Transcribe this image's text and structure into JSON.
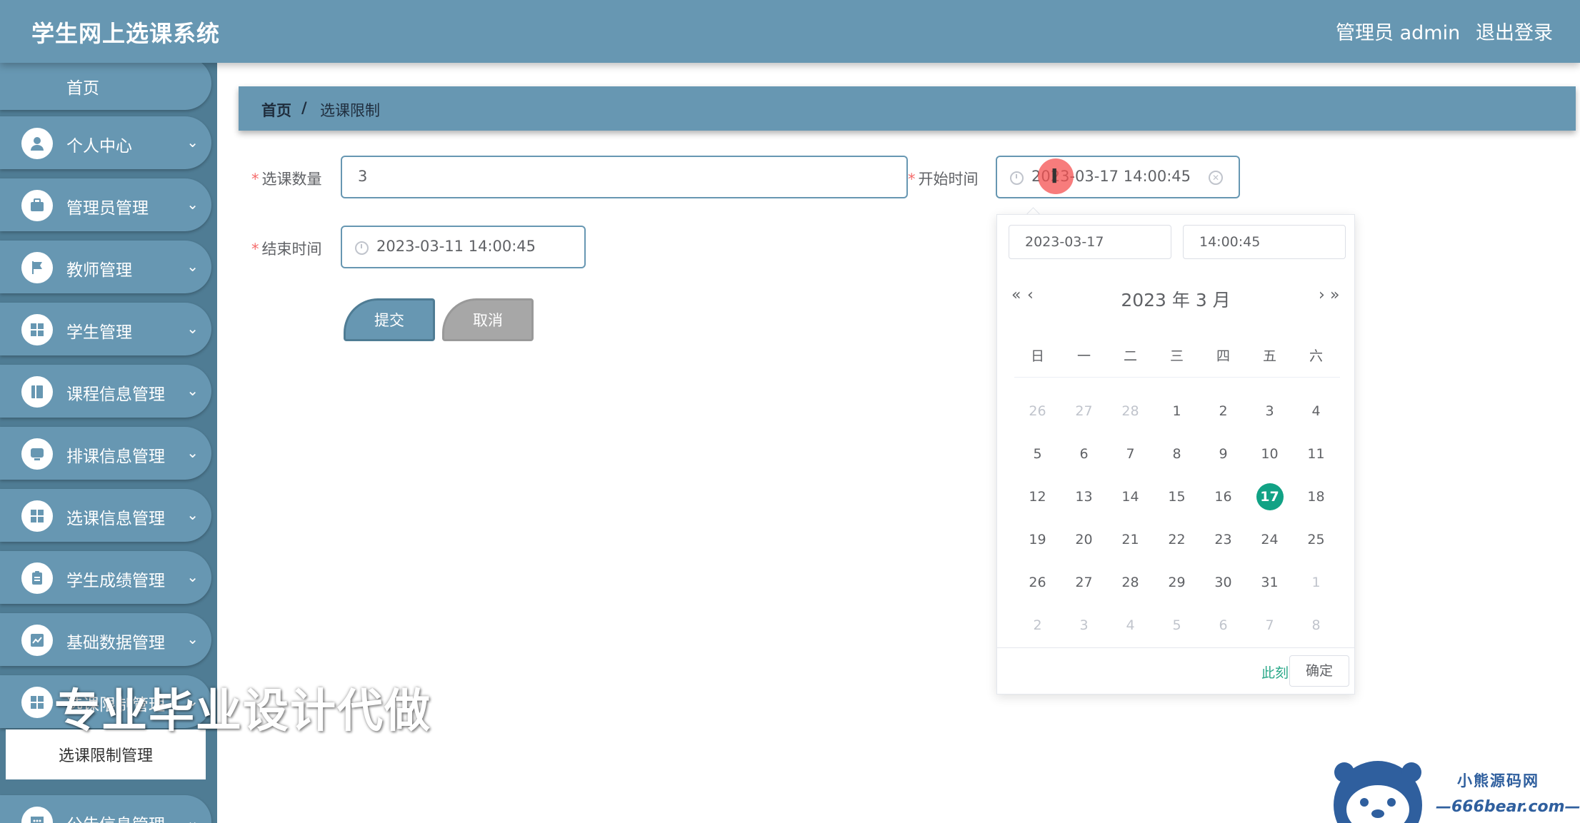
{
  "header": {
    "title": "学生网上选课系统",
    "user": "管理员 admin",
    "logout": "退出登录"
  },
  "sidebar": {
    "home": "首页",
    "items": [
      {
        "label": "个人中心",
        "icon": "user-icon"
      },
      {
        "label": "管理员管理",
        "icon": "briefcase-icon"
      },
      {
        "label": "教师管理",
        "icon": "flag-icon"
      },
      {
        "label": "学生管理",
        "icon": "grid-icon"
      },
      {
        "label": "课程信息管理",
        "icon": "book-icon"
      },
      {
        "label": "排课信息管理",
        "icon": "monitor-icon"
      },
      {
        "label": "选课信息管理",
        "icon": "grid-icon"
      },
      {
        "label": "学生成绩管理",
        "icon": "clipboard-icon"
      },
      {
        "label": "基础数据管理",
        "icon": "chart-icon"
      },
      {
        "label": "选课限制管理",
        "icon": "grid-icon"
      },
      {
        "label": "公告信息管理",
        "icon": "chat-icon"
      }
    ],
    "active_sub": "选课限制管理"
  },
  "breadcrumb": {
    "home": "首页",
    "sep": "/",
    "current": "选课限制"
  },
  "form": {
    "count_label": "选课数量",
    "count_value": "3",
    "start_label": "开始时间",
    "start_value": "2023-03-17 14:00:45",
    "end_label": "结束时间",
    "end_value": "2023-03-11 14:00:45",
    "required_mark": "*",
    "submit": "提交",
    "cancel": "取消"
  },
  "picker": {
    "date_value": "2023-03-17",
    "time_value": "14:00:45",
    "prev_year": "«",
    "prev_month": "‹",
    "next_month": "›",
    "next_year": "»",
    "year_month": "2023 年  3 月",
    "weekdays": [
      "日",
      "一",
      "二",
      "三",
      "四",
      "五",
      "六"
    ],
    "weeks": [
      [
        "26",
        "27",
        "28",
        "1",
        "2",
        "3",
        "4"
      ],
      [
        "5",
        "6",
        "7",
        "8",
        "9",
        "10",
        "11"
      ],
      [
        "12",
        "13",
        "14",
        "15",
        "16",
        "17",
        "18"
      ],
      [
        "19",
        "20",
        "21",
        "22",
        "23",
        "24",
        "25"
      ],
      [
        "26",
        "27",
        "28",
        "29",
        "30",
        "31",
        "1"
      ],
      [
        "2",
        "3",
        "4",
        "5",
        "6",
        "7",
        "8"
      ]
    ],
    "selected_day": "17",
    "now": "此刻",
    "ok": "确定"
  },
  "watermark": {
    "text": "专业毕业设计代做",
    "brand_cn": "小熊源码网",
    "brand_url": "—666bear.com—"
  },
  "colors": {
    "primary": "#6797b2",
    "sidebar": "#4f7c94",
    "selected": "#11a285",
    "required": "#f56c6c"
  }
}
